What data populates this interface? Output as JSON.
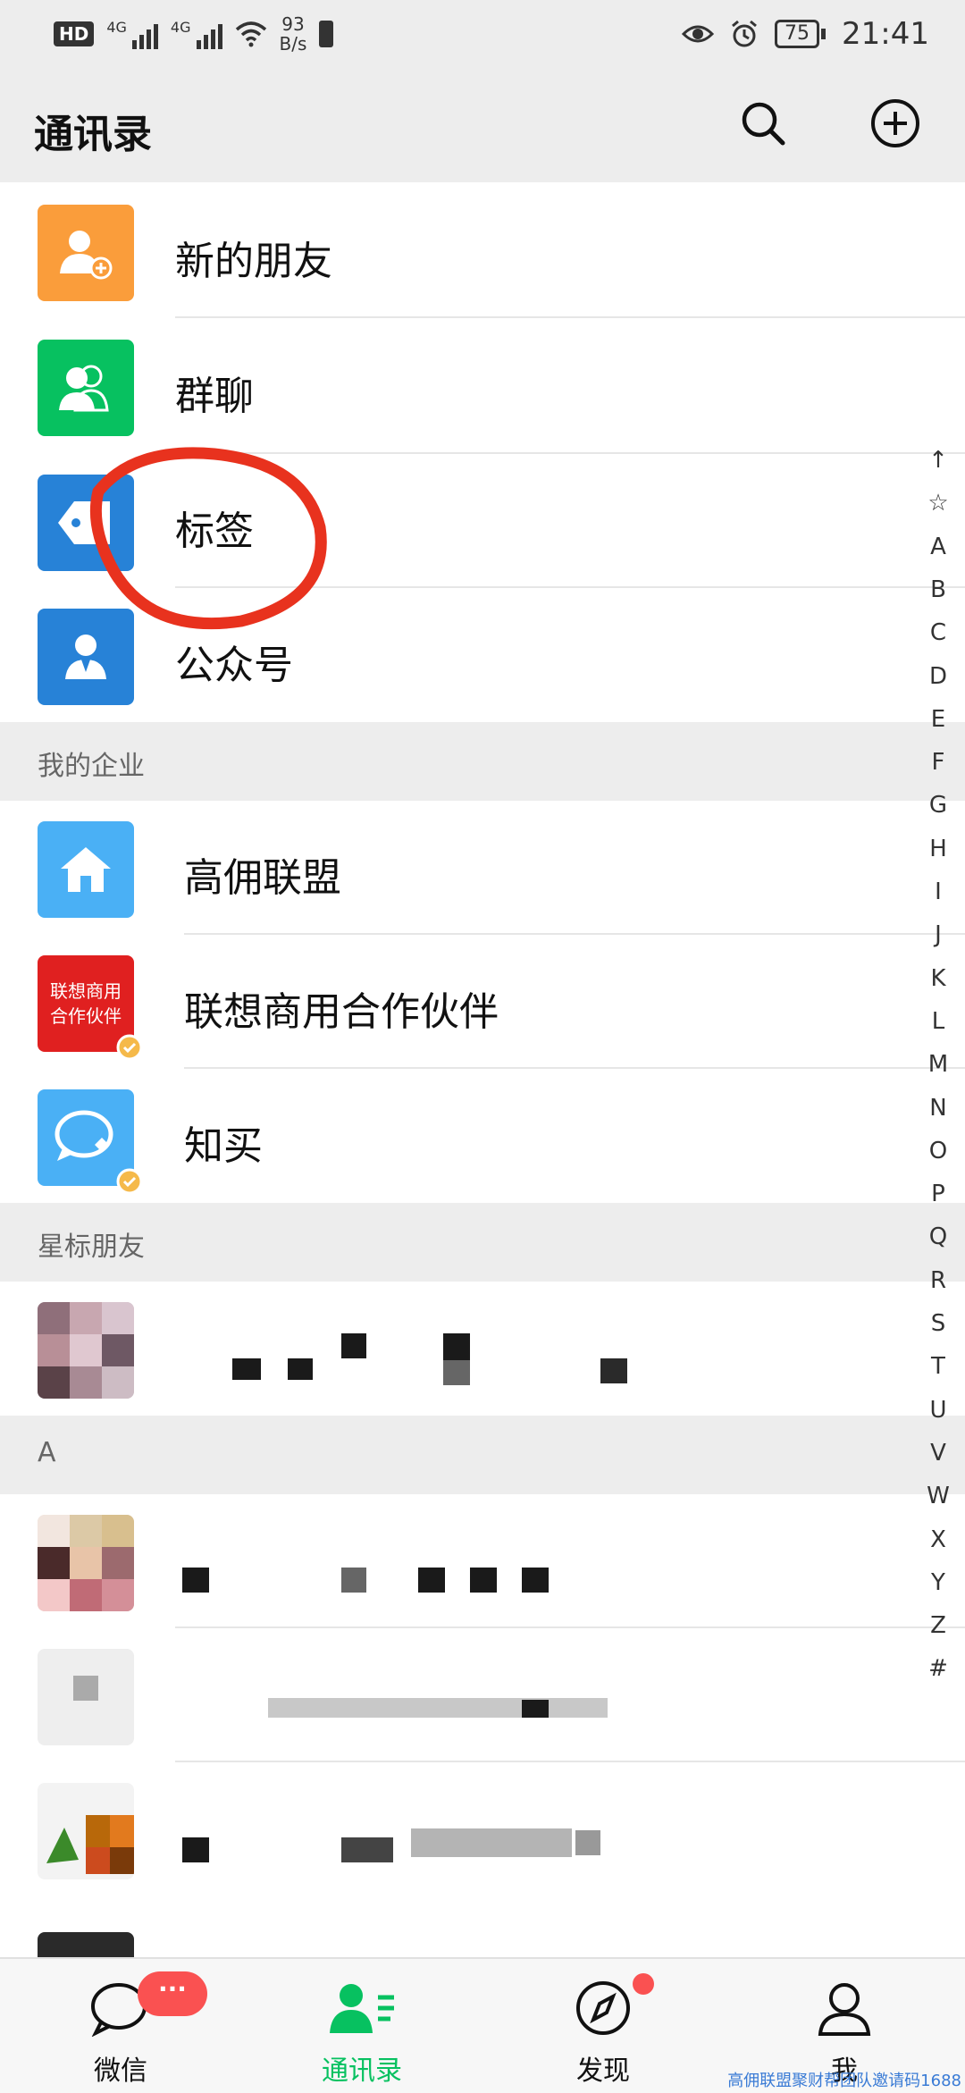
{
  "status_bar": {
    "hd": "HD",
    "sim1": "4G",
    "sim2": "4G",
    "speed_value": "93",
    "speed_unit": "B/s",
    "battery": "75",
    "time": "21:41"
  },
  "header": {
    "title": "通讯录",
    "search_icon": "search-icon",
    "add_icon": "plus-circle-icon"
  },
  "top_items": [
    {
      "label": "新的朋友",
      "icon": "add-friend-icon",
      "color": "#fa9d3b"
    },
    {
      "label": "群聊",
      "icon": "group-icon",
      "color": "#07c160"
    },
    {
      "label": "标签",
      "icon": "tag-icon",
      "color": "#2782d7"
    },
    {
      "label": "公众号",
      "icon": "official-account-icon",
      "color": "#2782d7"
    }
  ],
  "sections": {
    "enterprise": "我的企业",
    "starred": "星标朋友",
    "a": "A"
  },
  "enterprise_items": [
    {
      "label": "高佣联盟",
      "icon": "home-icon",
      "color": "#4ab0f5"
    },
    {
      "label": "联想商用合作伙伴",
      "icon_text": "联想商用合作伙伴",
      "color": "#e02020"
    },
    {
      "label": "知买",
      "icon": "chat-bubble-icon",
      "color": "#4ab0f5"
    }
  ],
  "index_letters": [
    "↑",
    "☆",
    "A",
    "B",
    "C",
    "D",
    "E",
    "F",
    "G",
    "H",
    "I",
    "J",
    "K",
    "L",
    "M",
    "N",
    "O",
    "P",
    "Q",
    "R",
    "S",
    "T",
    "U",
    "V",
    "W",
    "X",
    "Y",
    "Z",
    "#"
  ],
  "tabs": [
    {
      "label": "微信",
      "icon": "chat-icon",
      "badge": "···"
    },
    {
      "label": "通讯录",
      "icon": "contacts-icon"
    },
    {
      "label": "发现",
      "icon": "compass-icon"
    },
    {
      "label": "我",
      "icon": "person-icon"
    }
  ],
  "colors": {
    "accent": "#07c160",
    "badge": "#fa5151",
    "annotation": "#e8321e"
  },
  "watermark": "高佣联盟聚财帮团队邀请码1688"
}
